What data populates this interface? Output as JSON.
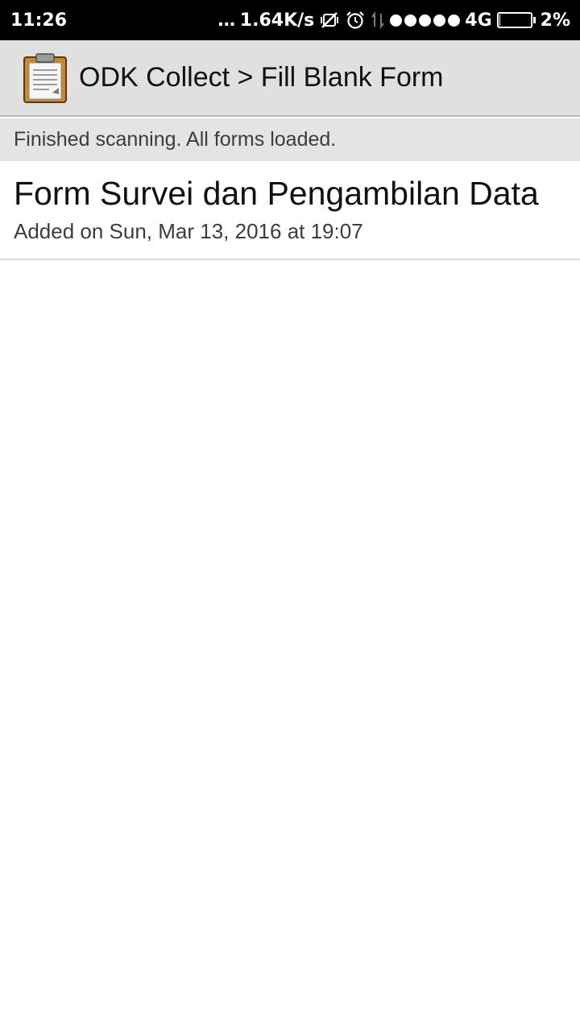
{
  "status_bar": {
    "time": "11:26",
    "more_indicator": "...",
    "network_speed": "1.64K/s",
    "network_type": "4G",
    "battery_percent": "2%",
    "battery_level": 0.02,
    "signal_bars": 5,
    "icons": [
      "vibrate-off-icon",
      "alarm-icon",
      "data-transfer-icon",
      "signal-icon",
      "battery-icon"
    ]
  },
  "action_bar": {
    "icon": "clipboard-icon",
    "title": "ODK Collect > Fill Blank Form"
  },
  "status_message": "Finished scanning. All forms loaded.",
  "forms": [
    {
      "title": "Form Survei dan Pengambilan Data",
      "subtitle": "Added on Sun, Mar 13, 2016 at 19:07"
    }
  ],
  "colors": {
    "status_bar_bg": "#000000",
    "action_bar_bg": "#e0e0e0",
    "status_strip_bg": "#e4e4e4",
    "clipboard_board": "#c98a2b",
    "list_bg": "#ffffff"
  }
}
